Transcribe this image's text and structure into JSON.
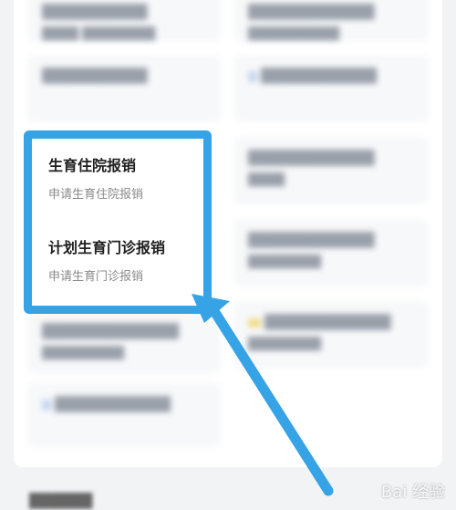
{
  "highlighted_items": [
    {
      "title": "生育住院报销",
      "subtitle": "申请生育住院报销"
    },
    {
      "title": "计划生育门诊报销",
      "subtitle": "申请生育门诊报销"
    }
  ],
  "blurred_cards": [
    {
      "title": "██████████",
      "subtitle": "████ ████████"
    },
    {
      "title": "████████████",
      "subtitle": "██████████"
    },
    {
      "title": "██████████",
      "subtitle": ""
    },
    {
      "title": "███████████",
      "subtitle": ""
    },
    {
      "title": "████████████",
      "subtitle": "████"
    },
    {
      "title": "████████████",
      "subtitle": "████████"
    },
    {
      "title": "█████████████",
      "subtitle": "█████████"
    },
    {
      "title": "████████████",
      "subtitle": "████████"
    },
    {
      "title": "███████████",
      "subtitle": ""
    }
  ],
  "bottom_section": "██████",
  "watermark": "Bai 经验",
  "colors": {
    "highlight": "#35a3e6",
    "arrow": "#35a3e6"
  }
}
